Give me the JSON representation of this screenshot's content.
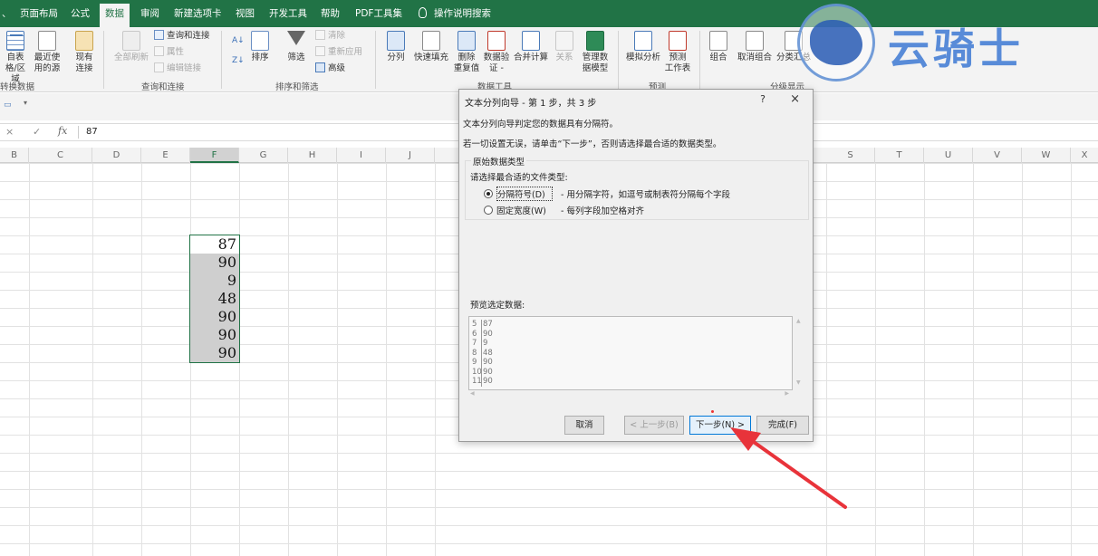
{
  "ribbon": {
    "tabs": [
      "、",
      "页面布局",
      "公式",
      "数据",
      "审阅",
      "新建选项卡",
      "视图",
      "开发工具",
      "帮助",
      "PDF工具集",
      "操作说明搜索"
    ],
    "active_tab": "数据",
    "items": {
      "from_table": "自表\n格/区域",
      "recent_sources": "最近使\n用的源",
      "existing_conn": "现有\n连接",
      "refresh_all": "全部刷新",
      "queries_conn": "查询和连接",
      "properties": "属性",
      "edit_links": "编辑链接",
      "sort": "排序",
      "filter": "筛选",
      "clear": "清除",
      "reapply": "重新应用",
      "advanced": "高级",
      "text_to_columns": "分列",
      "flash_fill": "快速填充",
      "remove_dup": "删除\n重复值",
      "data_validation": "数据验\n证 -",
      "consolidate": "合并计算",
      "relationships": "关系",
      "manage_model": "管理数\n据模型",
      "what_if": "模拟分析",
      "forecast": "预测\n工作表",
      "group": "组合",
      "ungroup": "取消组合",
      "subtotal": "分类汇总"
    },
    "groups": {
      "get_transform": "转换数据",
      "queries": "查询和连接",
      "sort_filter": "排序和筛选",
      "data_tools": "数据工具",
      "forecast": "预测",
      "outline": "分级显示"
    }
  },
  "formula_bar": {
    "cancel": "×",
    "enter": "✓",
    "fx": "fx",
    "value": "87"
  },
  "columns": [
    "B",
    "C",
    "D",
    "E",
    "F",
    "G",
    "H",
    "I",
    "J",
    "S",
    "T",
    "U",
    "V",
    "W",
    "X"
  ],
  "cells": [
    "87",
    "90",
    "9",
    "48",
    "90",
    "90",
    "90"
  ],
  "dialog": {
    "title": "文本分列向导 - 第 1 步，共 3 步",
    "help": "?",
    "close": "×",
    "line1": "文本分列向导判定您的数据具有分隔符。",
    "line2": "若一切设置无误，请单击“下一步”，否则请选择最合适的数据类型。",
    "group_legend": "原始数据类型",
    "prompt": "请选择最合适的文件类型:",
    "option1_label": "分隔符号(D)",
    "option1_desc": "- 用分隔字符，如逗号或制表符分隔每个字段",
    "option2_label": "固定宽度(W)",
    "option2_desc": "- 每列字段加空格对齐",
    "preview_label": "预览选定数据:",
    "preview_rows": [
      {
        "n": "5",
        "v": "87"
      },
      {
        "n": "6",
        "v": "90"
      },
      {
        "n": "7",
        "v": "9"
      },
      {
        "n": "8",
        "v": "48"
      },
      {
        "n": "9",
        "v": "90"
      },
      {
        "n": "10",
        "v": "90"
      },
      {
        "n": "11",
        "v": "90"
      }
    ],
    "buttons": {
      "cancel": "取消",
      "back": "< 上一步(B)",
      "next": "下一步(N) >",
      "finish": "完成(F)"
    }
  },
  "watermark": {
    "text": "云骑士"
  },
  "colors": {
    "excel_green": "#217346",
    "arrow_red": "#e8333a"
  }
}
